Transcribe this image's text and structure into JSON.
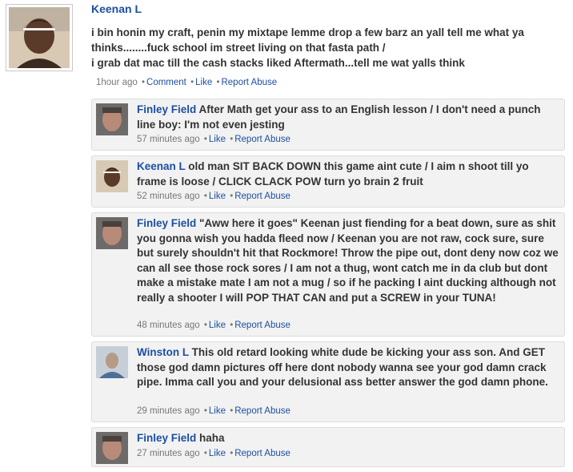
{
  "post": {
    "author": "Keenan L",
    "text": "i bin honin my craft, penin my mixtape lemme drop a few barz an yall tell me what ya thinks........fuck school im street living on that fasta path /\ni grab dat mac till the cash stacks liked Aftermath...tell me wat yalls think",
    "time": "1hour ago",
    "actions": {
      "comment": "Comment",
      "like": "Like",
      "report": "Report Abuse"
    }
  },
  "comments": [
    {
      "author": "Finley Field",
      "text": "After Math get your ass to an English lesson / I don't need a punch line boy: I'm not even jesting",
      "time": "57 minutes ago",
      "like": "Like",
      "report": "Report Abuse"
    },
    {
      "author": "Keenan L",
      "text": "old man SIT BACK DOWN this game aint cute / I aim n shoot till yo frame is loose / CLICK CLACK POW turn yo brain 2 fruit",
      "time": "52 minutes ago",
      "like": "Like",
      "report": "Report Abuse"
    },
    {
      "author": "Finley Field",
      "text": "\"Aww here it goes\" Keenan just fiending for a beat down, sure as shit you gonna wish you hadda fleed now / Keenan you are not raw, cock sure, sure but surely shouldn't hit that Rockmore! Throw the pipe out, dont deny now coz we can all see those rock sores / I am not a thug, wont catch me in da club but dont make a mistake mate I am not a mug / so if he packing I aint ducking although not really a shooter I will POP THAT CAN and put a SCREW in your TUNA!",
      "time": "48 minutes ago",
      "like": "Like",
      "report": "Report Abuse"
    },
    {
      "author": "Winston L",
      "text": "This old retard looking white dude be kicking your ass son. And GET those god damn pictures off here dont nobody wanna see your god damn crack pipe. Imma call you and your delusional ass better answer the god damn phone.",
      "time": "29 minutes ago",
      "like": "Like",
      "report": "Report Abuse"
    },
    {
      "author": "Finley Field",
      "text": "haha",
      "time": "27 minutes ago",
      "like": "Like",
      "report": "Report Abuse"
    }
  ],
  "colors": {
    "link": "#1c4fa0",
    "comment_bg": "#f2f2f2",
    "comment_border": "#dcdcdc",
    "text": "#333333",
    "meta": "#777777"
  }
}
